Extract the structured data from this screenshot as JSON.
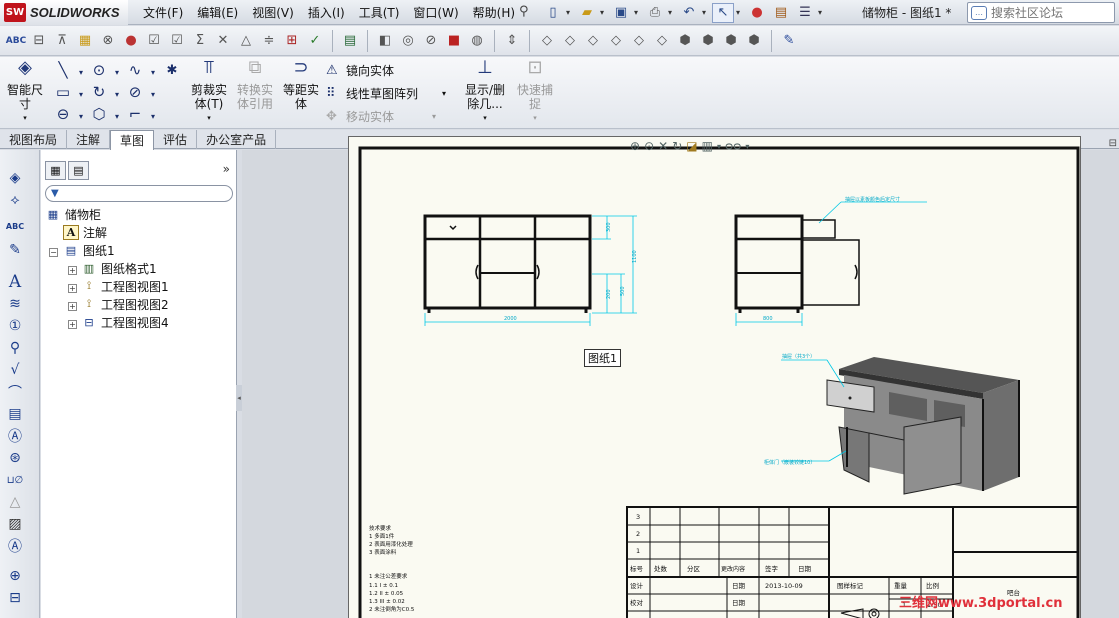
{
  "app": {
    "logo_badge": "SW",
    "logo_text": "SOLIDWORKS",
    "document_title": "储物柜 - 图纸1 *",
    "search_placeholder": "搜索社区论坛"
  },
  "menu": [
    "文件(F)",
    "编辑(E)",
    "视图(V)",
    "插入(I)",
    "工具(T)",
    "窗口(W)",
    "帮助(H)"
  ],
  "command_manager": {
    "smart_dimension": "智能尺\n寸",
    "trim_entities": "剪裁实\n体(T)",
    "convert_entities": "转换实\n体引用",
    "offset_entities": "等距实\n体",
    "mirror_entities": "镜向实体",
    "linear_pattern": "线性草图阵列",
    "move_entities": "移动实体",
    "display_delete": "显示/删\n除几...",
    "quick_snaps": "快速捕\n捉"
  },
  "tabs": [
    {
      "label": "视图布局",
      "active": false
    },
    {
      "label": "注解",
      "active": false
    },
    {
      "label": "草图",
      "active": true
    },
    {
      "label": "评估",
      "active": false
    },
    {
      "label": "办公室产品",
      "active": false
    }
  ],
  "tree": {
    "root": "储物柜",
    "annotations": "注解",
    "sheet": "图纸1",
    "children": [
      "图纸格式1",
      "工程图视图1",
      "工程图视图2",
      "工程图视图4"
    ]
  },
  "drawing": {
    "sheet_label": "图纸1",
    "dims_front": [
      "2000",
      "1100",
      "500",
      "300",
      "200"
    ],
    "dims_side": [
      "800"
    ],
    "callout_side": "抽屉以素板颜色后定尺寸",
    "callout_iso_drawer": "抽屉（共3个）",
    "callout_iso_door": "柜体门（嵌装铰链10）",
    "tech_requirements": [
      "技术要求",
      "1  多面1件",
      "2  表面用漆化处理",
      "3  表面涂料",
      "1  未注公差要求",
      "   1.1  I    ± 0.1",
      "   1.2  II   ± 0.05",
      "   1.3  III  ± 0.02",
      "2  未注倒角为C0.5"
    ],
    "title_block": {
      "rev_numbers": [
        "3",
        "2",
        "1"
      ],
      "headers": [
        "标号",
        "处数",
        "分区",
        "更改内容",
        "签字",
        "日期"
      ],
      "design": "设计",
      "check": "校对",
      "date_label": "日期",
      "date_value": "2013-10-09",
      "stage_mark": "图样标记",
      "weight": "重量",
      "scale": "比例",
      "weight_value": "1",
      "scale_value": "1:50",
      "part_name": "吧台"
    },
    "watermark": "三维网www.3dportal.cn"
  }
}
